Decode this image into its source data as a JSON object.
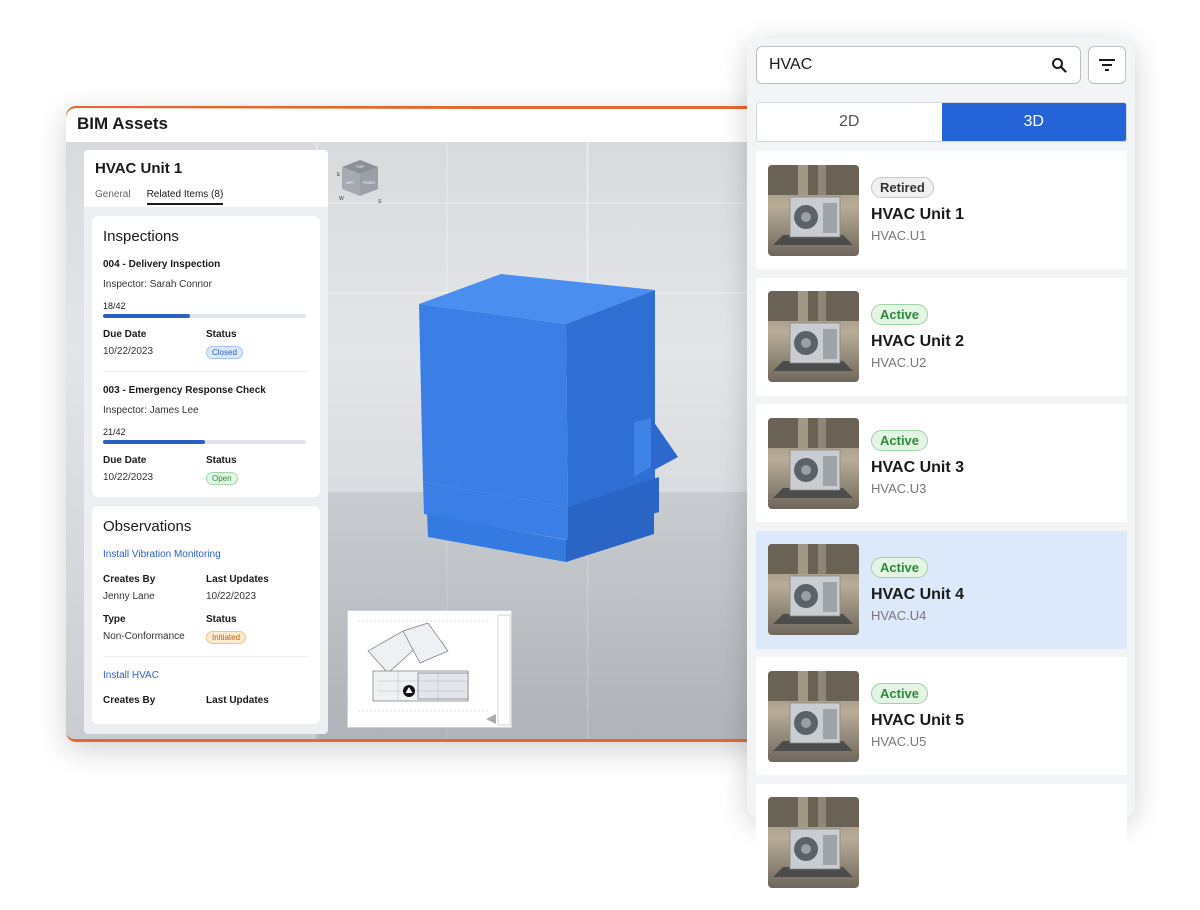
{
  "app": {
    "title": "BIM Assets"
  },
  "detail": {
    "title": "HVAC Unit 1",
    "tabs": [
      {
        "label": "General"
      },
      {
        "label": "Related Items (8)"
      }
    ],
    "inspections": {
      "heading": "Inspections",
      "items": [
        {
          "name": "004 - Delivery Inspection",
          "inspector": "Inspector: Sarah Connor",
          "count": "18/42",
          "progress": 0.43,
          "due_label": "Due Date",
          "due": "10/22/2023",
          "status_label": "Status",
          "status": "Closed"
        },
        {
          "name": "003 - Emergency Response Check",
          "inspector": "Inspector: James Lee",
          "count": "21/42",
          "progress": 0.5,
          "due_label": "Due Date",
          "due": "10/22/2023",
          "status_label": "Status",
          "status": "Open"
        }
      ]
    },
    "observations": {
      "heading": "Observations",
      "items": [
        {
          "name": "Install Vibration Monitoring",
          "created_label": "Creates By",
          "created": "Jenny Lane",
          "updated_label": "Last Updates",
          "updated": "10/22/2023",
          "type_label": "Type",
          "type": "Non-Conformance",
          "status_label": "Status",
          "status": "Initiated"
        },
        {
          "name": "Install HVAC",
          "created_label": "Creates By",
          "updated_label": "Last Updates"
        }
      ]
    }
  },
  "viewcube": {
    "top": "TOP",
    "left": "LEFT",
    "front": "FRONT",
    "w": "W",
    "s": "S",
    "e": "E"
  },
  "search": {
    "value": "HVAC",
    "toggle": [
      {
        "label": "2D"
      },
      {
        "label": "3D",
        "selected": true
      }
    ],
    "results": [
      {
        "status": "Retired",
        "name": "HVAC Unit 1",
        "code": "HVAC.U1"
      },
      {
        "status": "Active",
        "name": "HVAC Unit 2",
        "code": "HVAC.U2"
      },
      {
        "status": "Active",
        "name": "HVAC Unit 3",
        "code": "HVAC.U3"
      },
      {
        "status": "Active",
        "name": "HVAC Unit 4",
        "code": "HVAC.U4",
        "selected": true
      },
      {
        "status": "Active",
        "name": "HVAC Unit 5",
        "code": "HVAC.U5"
      }
    ]
  },
  "colors": {
    "accent": "#2563d9",
    "model": "#3f86e8",
    "highlight": "#dbe9fb",
    "frame": "#e5692e"
  }
}
